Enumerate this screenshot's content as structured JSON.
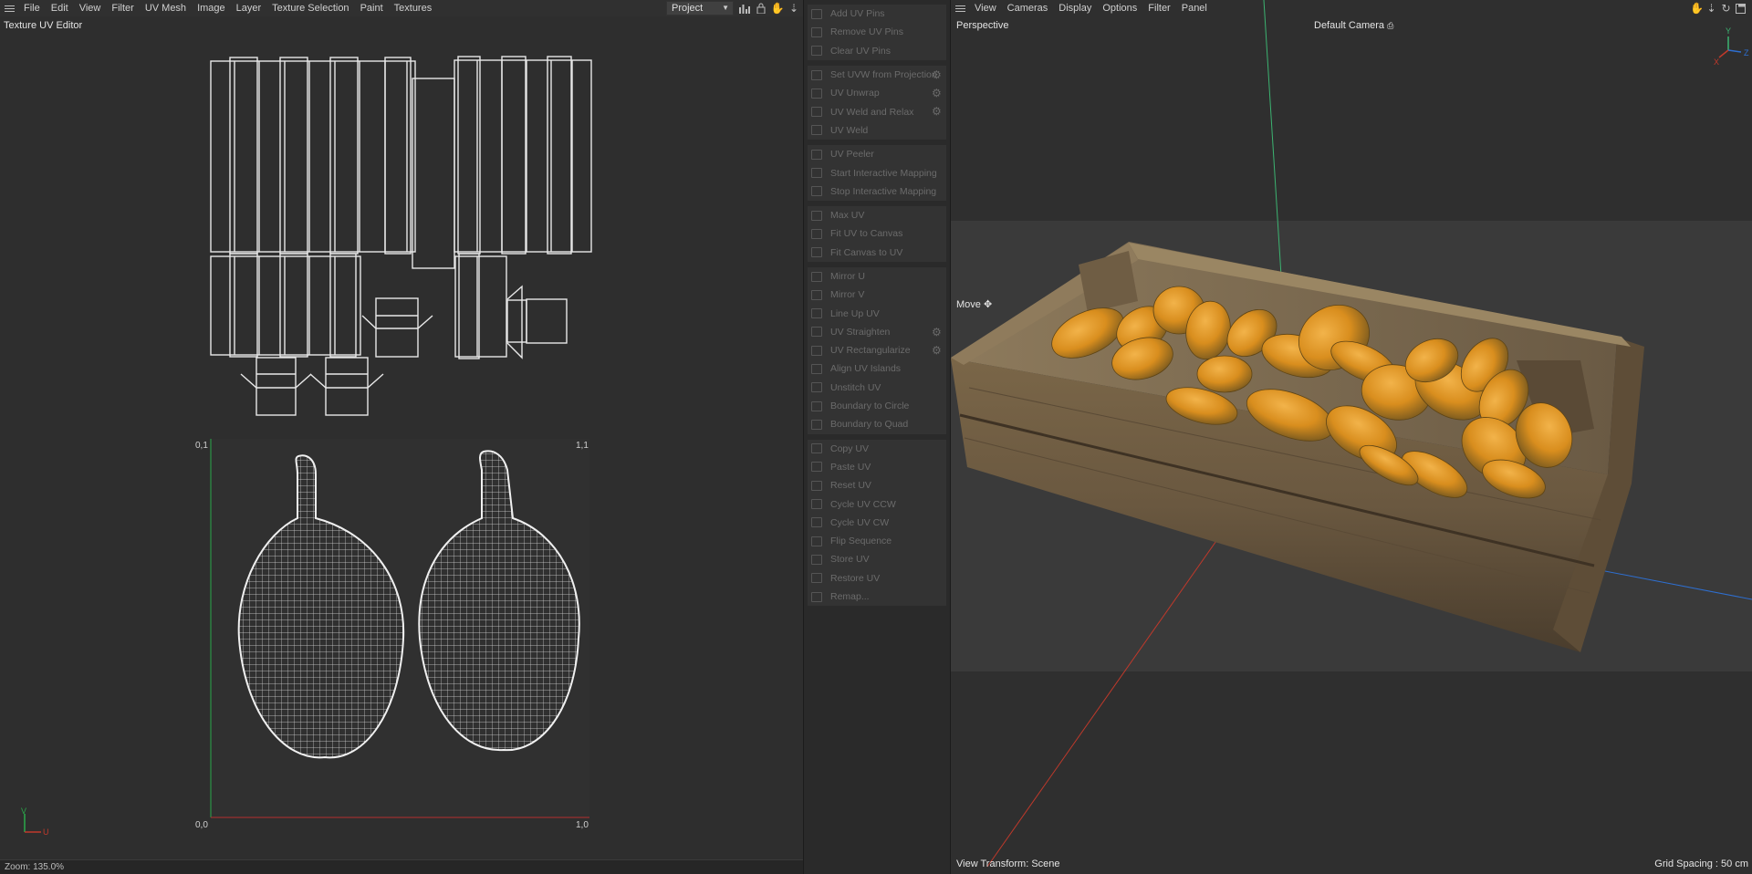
{
  "uv_editor": {
    "menu": [
      "File",
      "Edit",
      "View",
      "Filter",
      "UV Mesh",
      "Image",
      "Layer",
      "Texture Selection",
      "Paint",
      "Textures"
    ],
    "project_select": "Project",
    "title": "Texture UV Editor",
    "corner_labels": {
      "top_left": "0,1",
      "top_right": "1,1",
      "bottom_left": "0,0",
      "bottom_right": "1,0"
    },
    "axis_labels": {
      "v": "V",
      "u": "U"
    },
    "zoom_status": "Zoom: 135.0%",
    "toolbar_icons": [
      "histogram-icon",
      "lock-icon",
      "hand-pan-icon",
      "pin-icon"
    ]
  },
  "uv_commands": {
    "groups": [
      [
        {
          "label": "Add UV Pins",
          "icon": "pin-add-icon",
          "gear": false
        },
        {
          "label": "Remove UV Pins",
          "icon": "pin-remove-icon",
          "gear": false
        },
        {
          "label": "Clear UV Pins",
          "icon": "pin-clear-icon",
          "gear": false
        }
      ],
      [
        {
          "label": "Set UVW from Projection",
          "icon": "projection-icon",
          "gear": true
        },
        {
          "label": "UV Unwrap",
          "icon": "unwrap-icon",
          "gear": true
        },
        {
          "label": "UV Weld and Relax",
          "icon": "weld-relax-icon",
          "gear": true
        },
        {
          "label": "UV Weld",
          "icon": "weld-icon",
          "gear": false
        }
      ],
      [
        {
          "label": "UV Peeler",
          "icon": "peeler-icon",
          "gear": false
        },
        {
          "label": "Start Interactive Mapping",
          "icon": "play-icon",
          "gear": false
        },
        {
          "label": "Stop Interactive Mapping",
          "icon": "stop-icon",
          "gear": false
        }
      ],
      [
        {
          "label": "Max UV",
          "icon": "max-uv-icon",
          "gear": false
        },
        {
          "label": "Fit UV to Canvas",
          "icon": "fit-uv-icon",
          "gear": false
        },
        {
          "label": "Fit Canvas to UV",
          "icon": "fit-canvas-icon",
          "gear": false
        }
      ],
      [
        {
          "label": "Mirror U",
          "icon": "mirror-u-icon",
          "gear": false
        },
        {
          "label": "Mirror V",
          "icon": "mirror-v-icon",
          "gear": false
        },
        {
          "label": "Line Up UV",
          "icon": "line-up-icon",
          "gear": false
        },
        {
          "label": "UV Straighten",
          "icon": "straighten-icon",
          "gear": true
        },
        {
          "label": "UV Rectangularize",
          "icon": "rectangularize-icon",
          "gear": true
        },
        {
          "label": "Align UV Islands",
          "icon": "align-icon",
          "gear": false
        },
        {
          "label": "Unstitch UV",
          "icon": "unstitch-icon",
          "gear": false
        },
        {
          "label": "Boundary to Circle",
          "icon": "circle-icon",
          "gear": false
        },
        {
          "label": "Boundary to Quad",
          "icon": "quad-icon",
          "gear": false
        }
      ],
      [
        {
          "label": "Copy UV",
          "icon": "copy-icon",
          "gear": false
        },
        {
          "label": "Paste UV",
          "icon": "paste-icon",
          "gear": false
        },
        {
          "label": "Reset UV",
          "icon": "reset-icon",
          "gear": false
        },
        {
          "label": "Cycle UV CCW",
          "icon": "ccw-icon",
          "gear": false
        },
        {
          "label": "Cycle UV CW",
          "icon": "cw-icon",
          "gear": false
        },
        {
          "label": "Flip Sequence",
          "icon": "flip-icon",
          "gear": false
        },
        {
          "label": "Store UV",
          "icon": "store-icon",
          "gear": false
        },
        {
          "label": "Restore UV",
          "icon": "restore-icon",
          "gear": false
        },
        {
          "label": "Remap...",
          "icon": "remap-icon",
          "gear": false
        }
      ]
    ]
  },
  "viewport": {
    "menu": [
      "View",
      "Cameras",
      "Display",
      "Options",
      "Filter",
      "Panel"
    ],
    "view_name": "Perspective",
    "camera": "Default Camera",
    "tool": "Move",
    "view_transform": "View Transform: Scene",
    "grid_spacing": "Grid Spacing : 50 cm",
    "axis_gizmo": {
      "y": "Y",
      "z": "Z",
      "x": "X"
    },
    "nav_icons": [
      "hand-pan-icon",
      "move-arrows-icon",
      "rotate-icon",
      "maximize-icon"
    ],
    "colors": {
      "x_axis": "#c0392b",
      "y_axis": "#3cb371",
      "z_axis": "#2e6fd1"
    }
  }
}
